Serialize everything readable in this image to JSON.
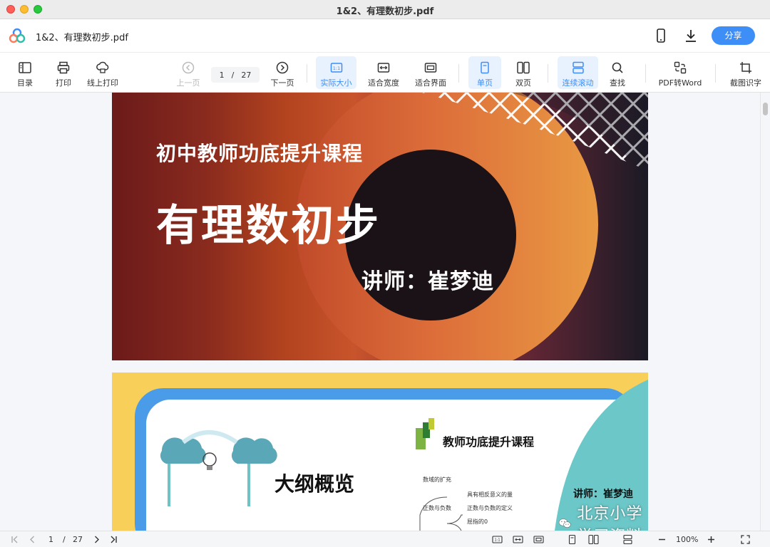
{
  "window": {
    "title": "1&2、有理数初步.pdf"
  },
  "header": {
    "doc_title": "1&2、有理数初步.pdf",
    "share_label": "分享"
  },
  "toolbar": {
    "toc": "目录",
    "print": "打印",
    "online_print": "线上打印",
    "prev_page": "上一页",
    "next_page": "下一页",
    "current_page": "1",
    "separator": "/",
    "total_pages": "27",
    "actual_size": "实际大小",
    "fit_width": "适合宽度",
    "fit_screen": "适合界面",
    "single_page": "单页",
    "double_page": "双页",
    "continuous_scroll": "连续滚动",
    "find": "查找",
    "pdf_to_word": "PDF转Word",
    "ocr": "截图识字",
    "actual_size_glyph": "1:1"
  },
  "page1": {
    "course": "初中教师功底提升课程",
    "title": "有理数初步",
    "teacher": "讲师：崔梦迪"
  },
  "page2": {
    "outline": "大纲概览",
    "course": "教师功底提升课程",
    "teacher": "讲师：崔梦迪",
    "mindmap": {
      "n1": "数域的扩充",
      "n2": "正数与负数",
      "n3": "具有相反意义的量",
      "n4": "正数与负数的定义",
      "n5": "屈指的0"
    },
    "watermark": "北京小学学习资料"
  },
  "statusbar": {
    "current_page": "1",
    "separator": "/",
    "total_pages": "27",
    "zoom": "100%",
    "actual_size_glyph": "1:1"
  },
  "colors": {
    "accent": "#3d8ef7",
    "active_bg": "#e8f1fe",
    "close": "#fe5f57",
    "minimize": "#febc2e",
    "maximize": "#28c840"
  }
}
